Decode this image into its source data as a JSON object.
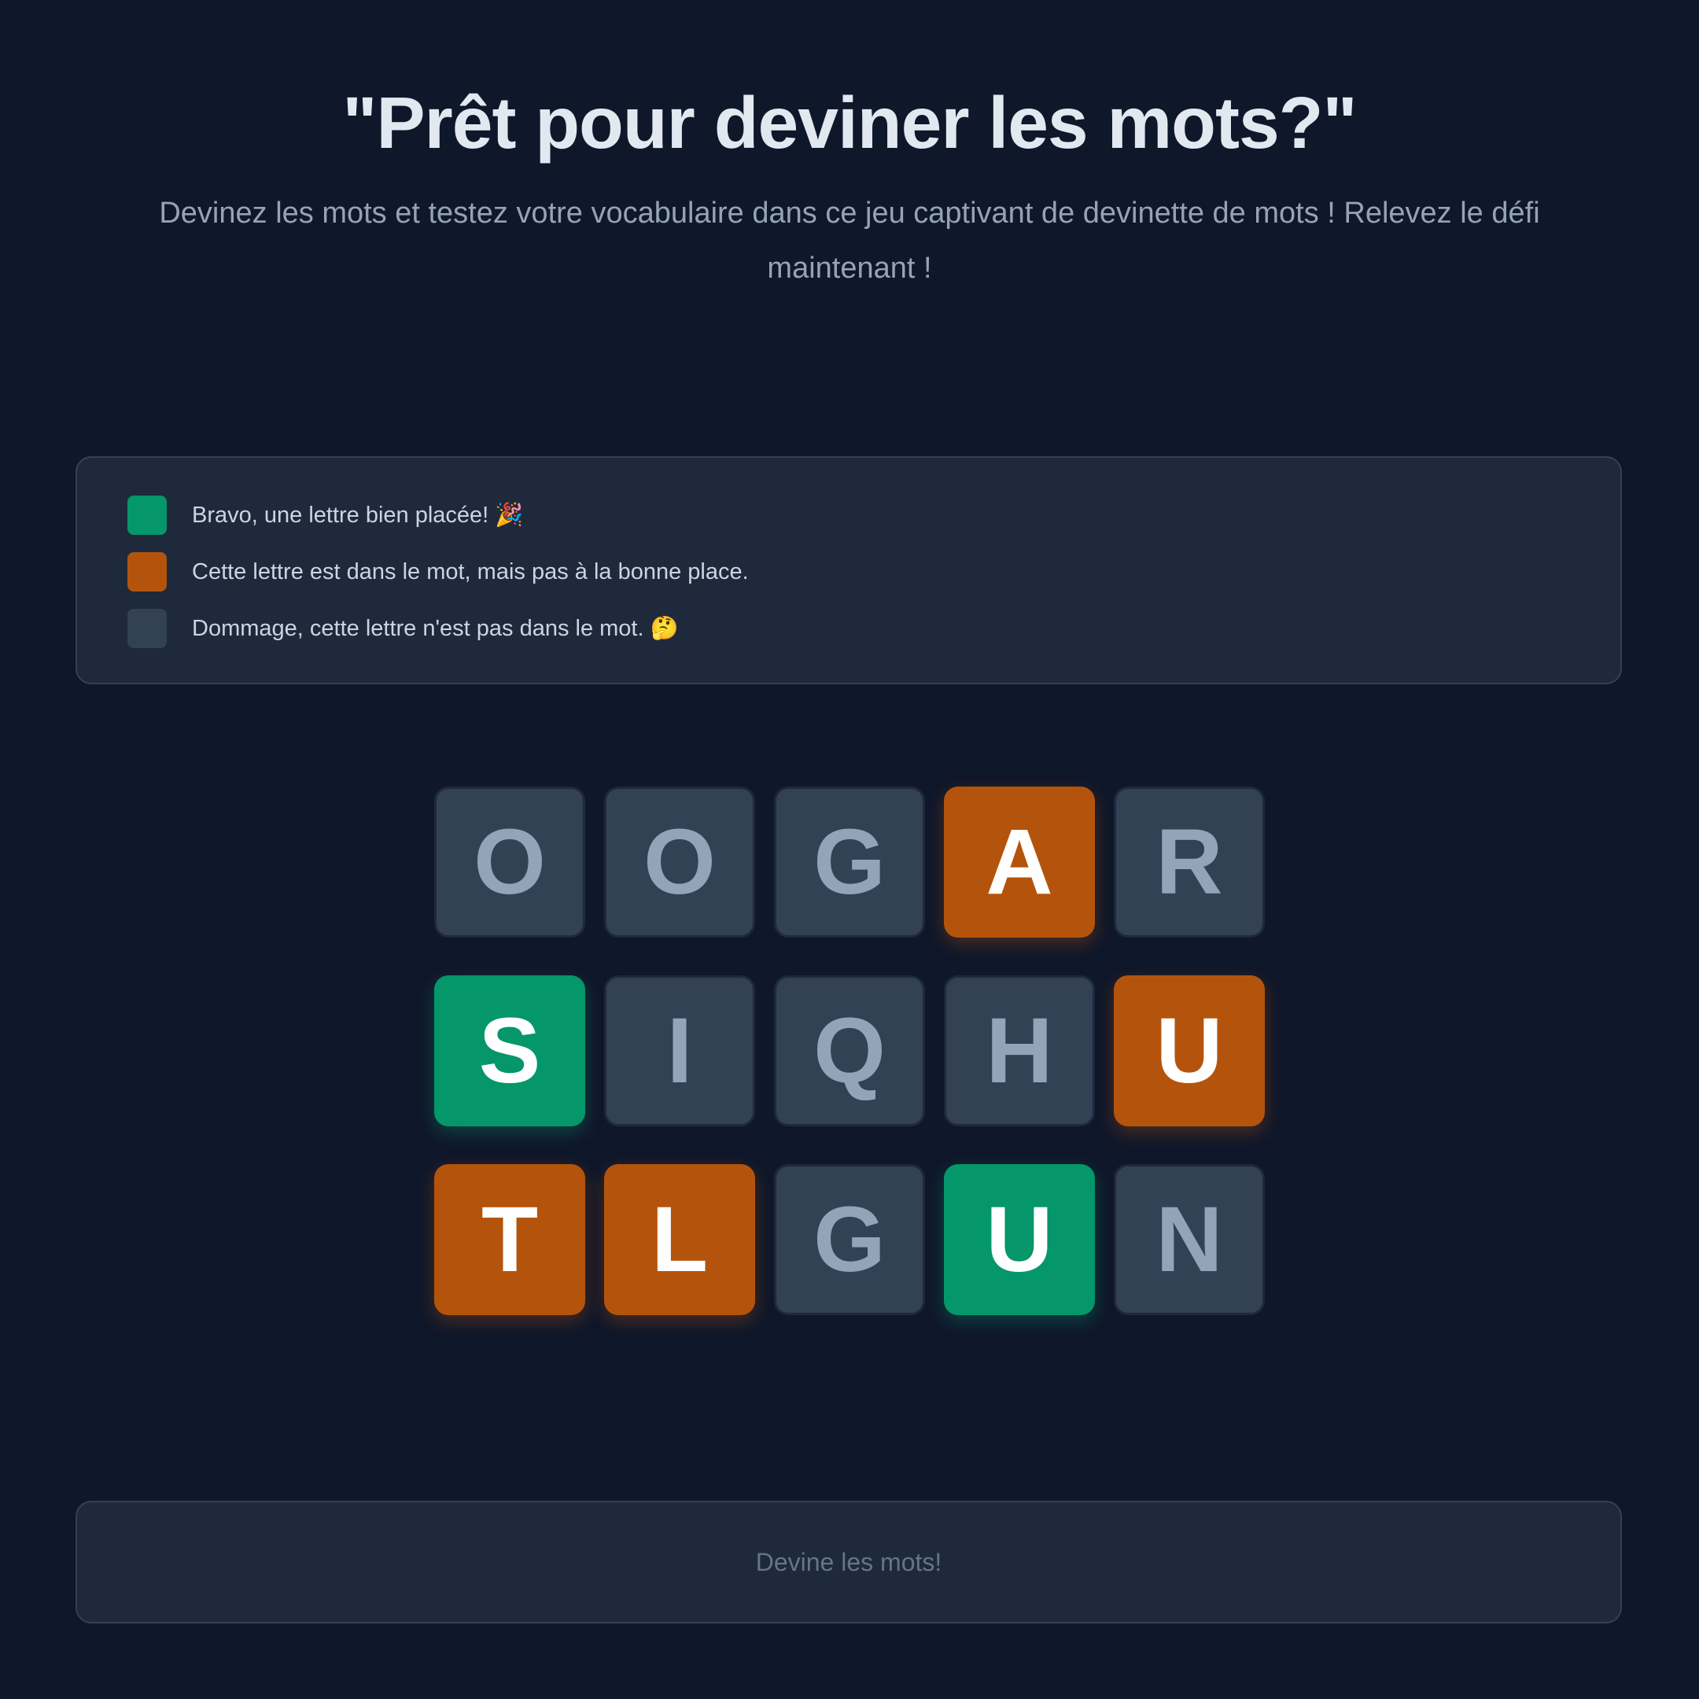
{
  "header": {
    "title": "\"Prêt pour deviner les mots?\"",
    "subtitle": "Devinez les mots et testez votre vocabulaire dans ce jeu captivant de devinette de mots ! Relevez le défi maintenant !"
  },
  "legend": {
    "items": [
      {
        "label": "Bravo, une lettre bien placée! 🎉",
        "status": "correct",
        "color": "#059669"
      },
      {
        "label": "Cette lettre est dans le mot, mais pas à la bonne place.",
        "status": "present",
        "color": "#b4540c"
      },
      {
        "label": "Dommage, cette lettre n'est pas dans le mot. 🤔",
        "status": "absent",
        "color": "#334155"
      }
    ]
  },
  "board": {
    "rows": [
      {
        "letters": [
          "O",
          "O",
          "G",
          "A",
          "R"
        ],
        "states": [
          "absent",
          "absent",
          "absent",
          "present",
          "absent"
        ]
      },
      {
        "letters": [
          "S",
          "I",
          "Q",
          "H",
          "U"
        ],
        "states": [
          "correct",
          "absent",
          "absent",
          "absent",
          "present"
        ]
      },
      {
        "letters": [
          "T",
          "L",
          "G",
          "U",
          "N"
        ],
        "states": [
          "present",
          "present",
          "absent",
          "correct",
          "absent"
        ]
      }
    ]
  },
  "guess_input": {
    "value": "",
    "placeholder": "Devine les mots!"
  },
  "colors": {
    "background": "#0f172a",
    "panel": "#1e293b",
    "correct": "#059669",
    "present": "#b4540c",
    "absent": "#334155"
  }
}
